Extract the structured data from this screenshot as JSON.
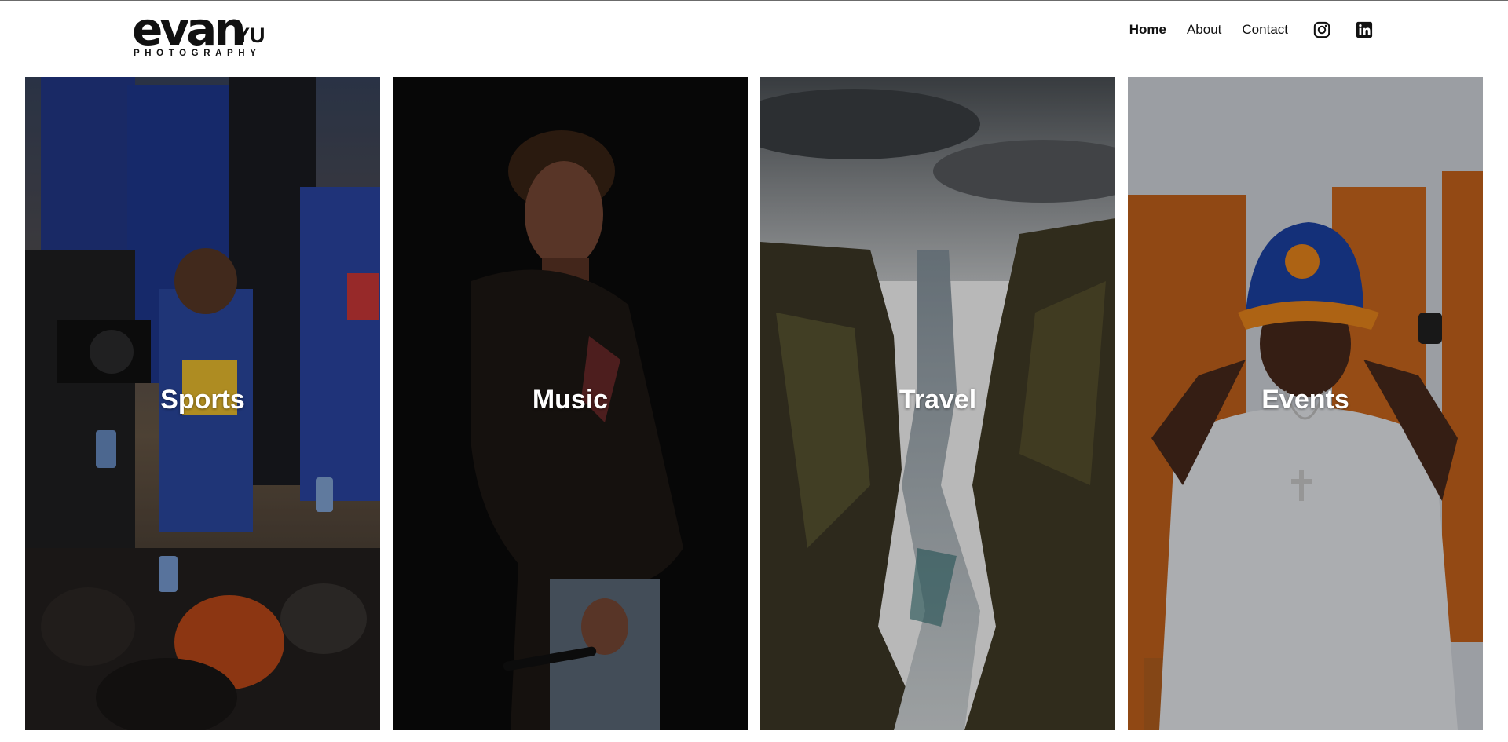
{
  "brand": {
    "logo_word": "evan",
    "logo_surname": "YU",
    "logo_subtitle": "PHOTOGRAPHY"
  },
  "nav": {
    "items": [
      {
        "label": "Home",
        "active": true
      },
      {
        "label": "About",
        "active": false
      },
      {
        "label": "Contact",
        "active": false
      }
    ],
    "social": [
      {
        "icon": "instagram-icon"
      },
      {
        "icon": "linkedin-icon"
      }
    ]
  },
  "gallery": {
    "tiles": [
      {
        "label": "Sports",
        "photo": "basketball-players-crowd"
      },
      {
        "label": "Music",
        "photo": "performer-on-dark-stage"
      },
      {
        "label": "Travel",
        "photo": "canyon-river-landscape"
      },
      {
        "label": "Events",
        "photo": "man-in-knicks-cap"
      }
    ]
  },
  "colors": {
    "text": "#111111",
    "tile_label": "#ffffff",
    "background": "#ffffff"
  }
}
